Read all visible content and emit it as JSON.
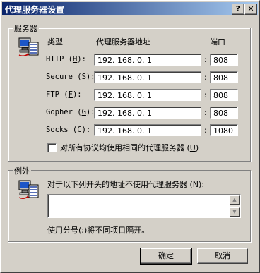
{
  "window": {
    "title": "代理服务器设置",
    "help_label": "?",
    "close_label": "✕"
  },
  "servers": {
    "group_label": "服务器",
    "col_type": "类型",
    "col_address": "代理服务器地址",
    "col_port": "端口",
    "rows": [
      {
        "label": "HTTP",
        "accel": "H",
        "address": "192. 168. 0. 1",
        "port": "808"
      },
      {
        "label": "Secure",
        "accel": "S",
        "address": "192. 168. 0. 1",
        "port": "808"
      },
      {
        "label": "FTP",
        "accel": "F",
        "address": "192. 168. 0. 1",
        "port": "808"
      },
      {
        "label": "Gopher",
        "accel": "G",
        "address": "192. 168. 0. 1",
        "port": "808"
      },
      {
        "label": "Socks",
        "accel": "C",
        "address": "192. 168. 0. 1",
        "port": "1080"
      }
    ],
    "same_proxy_label": "对所有协议均使用相同的代理服务器",
    "same_proxy_accel": "U",
    "same_proxy_checked": false
  },
  "exceptions": {
    "group_label": "例外",
    "prompt": "对于以下列开头的地址不使用代理服务器",
    "prompt_accel": "N",
    "value": "",
    "hint": "使用分号(;)将不同项目隔开。"
  },
  "buttons": {
    "ok": "确定",
    "cancel": "取消"
  }
}
